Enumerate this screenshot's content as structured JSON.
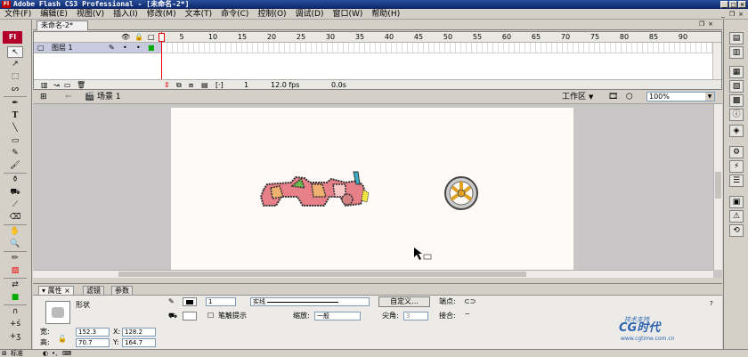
{
  "window": {
    "title": "Adobe Flash CS3 Professional - [未命名-2*]"
  },
  "menu": [
    "文件(F)",
    "编辑(E)",
    "视图(V)",
    "插入(I)",
    "修改(M)",
    "文本(T)",
    "命令(C)",
    "控制(O)",
    "调试(D)",
    "窗口(W)",
    "帮助(H)"
  ],
  "tools": {
    "logo": "Fl"
  },
  "document": {
    "tab": "未命名-2*"
  },
  "timeline": {
    "ruler": [
      "5",
      "10",
      "15",
      "20",
      "25",
      "30",
      "35",
      "40",
      "45",
      "50",
      "55",
      "60",
      "65",
      "70",
      "75",
      "80",
      "85",
      "90"
    ],
    "layer": "图层 1",
    "frame": "1",
    "fps": "12.0 fps",
    "time": "0.0s"
  },
  "editbar": {
    "scene": "场景 1",
    "workspace": "工作区",
    "zoom": "100%"
  },
  "properties": {
    "tabs": [
      "属性",
      "滤镜",
      "参数"
    ],
    "type": "形状",
    "stroke_height": "1",
    "stroke_style": "实线",
    "custom": "自定义...",
    "cap_label": "端点:",
    "stroke_hinting": "笔触提示",
    "scale_label": "缩放:",
    "scale_value": "一般",
    "miter_label": "尖角:",
    "miter_value": "3",
    "join_label": "接合:",
    "w_label": "宽:",
    "w": "152.3",
    "x_label": "X:",
    "x": "128.2",
    "h_label": "高:",
    "h": "70.7",
    "y_label": "Y:",
    "y": "164.7",
    "watermark_top": "技术支持",
    "watermark_main": "CG时代",
    "watermark_url": "www.cgtime.com.cn"
  },
  "statusbar": {
    "start": "标准"
  },
  "colors": {
    "stage": "#fdfaf8",
    "pasteboard": "#c8c6c6",
    "layer_highlight": "#c8cbe0",
    "playhead": "#ee0000",
    "logo": "#b2002b"
  }
}
